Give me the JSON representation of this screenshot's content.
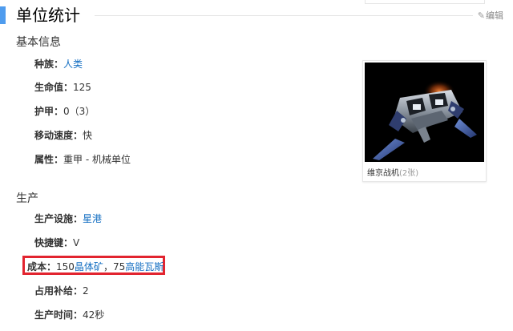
{
  "section": {
    "title": "单位统计",
    "edit_label": "编辑",
    "edit_icon": "pencil-icon"
  },
  "basic": {
    "heading": "基本信息",
    "race": {
      "label": "种族：",
      "value": "人类"
    },
    "hp": {
      "label": "生命值：",
      "value": "125"
    },
    "armor": {
      "label": "护甲：",
      "value": "0（3）"
    },
    "speed": {
      "label": "移动速度：",
      "value": "快"
    },
    "attributes": {
      "label": "属性：",
      "value": "重甲 - 机械单位"
    }
  },
  "production": {
    "heading": "生产",
    "facility": {
      "label": "生产设施：",
      "value": "星港"
    },
    "hotkey": {
      "label": "快捷键：",
      "value": "V"
    },
    "cost": {
      "label": "成本：",
      "minerals_amount": "150",
      "minerals": "晶体矿",
      "separator": "，",
      "gas_amount": "75",
      "gas": "高能瓦斯"
    },
    "supply": {
      "label": "占用补给：",
      "value": "2"
    },
    "time": {
      "label": "生产时间：",
      "value": "42秒"
    }
  },
  "figure": {
    "caption": "维京战机",
    "count": "(2张)"
  },
  "colors": {
    "accent": "#4f9cee",
    "link": "#136ec2",
    "highlight": "#e2242f"
  }
}
